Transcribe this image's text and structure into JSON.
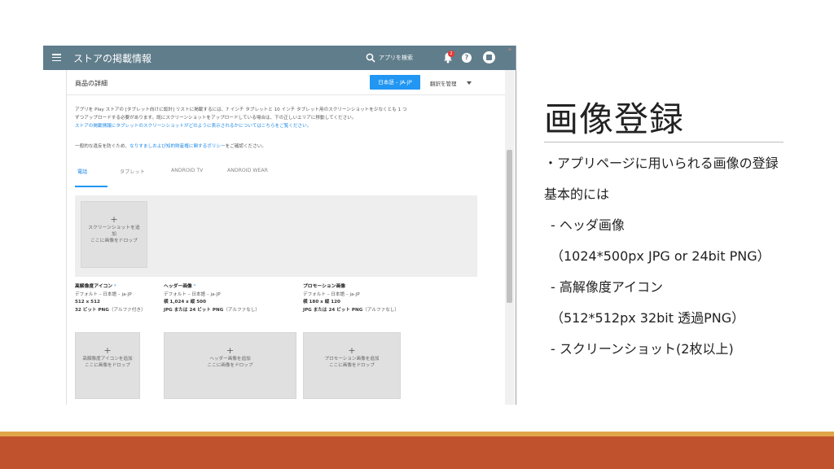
{
  "slide": {
    "title": "画像登録",
    "bullets": [
      "・アプリページに用いられる画像の登録",
      "基本的には",
      "- ヘッダ画像",
      "（1024*500px JPG or 24bit PNG）",
      "- 高解像度アイコン",
      "（512*512px 32bit 透過PNG）",
      "- スクリーンショット(2枚以上)"
    ],
    "colors": {
      "footer_thin": "#e0a54a",
      "footer_bar": "#c0522d"
    }
  },
  "app": {
    "title": "ストアの掲載情報",
    "search_placeholder": "アプリを検索",
    "notification_count": "2",
    "help_label": "?",
    "colors": {
      "topbar": "#607d8b",
      "accent": "#2196f3"
    }
  },
  "content": {
    "heading": "商品の詳細",
    "language_button": "日本語 – JA-JP",
    "translate_button": "翻訳を管理",
    "desc_line1": "アプリを Play ストアの [タブレット向けに設計] リストに掲載するには、7 インチ タブレットと 10 インチ タブレット用のスクリーンショットを少なくとも 1 つ",
    "desc_line2": "ずつアップロードする必要があります。既にスクリーンショットをアップロードしている場合は、下の正しいエリアに移動してください。",
    "desc_link": "ストアの掲載情報にタブレットのスクリーンショットがどのように表示されるかについてはこちらをご覧ください。",
    "policy_prefix": "一般的な違反を防ぐため、",
    "policy_link": "なりすましおよび知的財産権に関するポリシー",
    "policy_suffix": "をご確認ください。",
    "tabs": [
      "電話",
      "タブレット",
      "ANDROID TV",
      "ANDROID WEAR"
    ],
    "screenshot_drop_line1": "スクリーンショットを追",
    "screenshot_drop_line2": "加",
    "screenshot_drop_line3": "ここに画像をドロップ",
    "plus": "+",
    "assets": [
      {
        "title": "高解像度アイコン",
        "required": "*",
        "lang": "デフォルト – 日本語 – ja-JP",
        "size": "512 x 512",
        "format_bold": "32 ビット PNG",
        "format_rest": "（アルファ付き）",
        "drop_line1": "高解像度アイコンを追加",
        "drop_line2": "ここに画像をドロップ"
      },
      {
        "title": "ヘッダー画像",
        "required": "*",
        "lang": "デフォルト – 日本語 – ja-JP",
        "size": "横 1,024 x 縦 500",
        "format_bold": "JPG または 24 ビット PNG",
        "format_rest": "（アルファなし）",
        "drop_line1": "ヘッダー画像を追加",
        "drop_line2": "ここに画像をドロップ"
      },
      {
        "title": "プロモーション画像",
        "required": "",
        "lang": "デフォルト – 日本語 – ja-JP",
        "size": "横 180 x 縦 120",
        "format_bold": "JPG または 24 ビット PNG",
        "format_rest": "（アルファなし）",
        "drop_line1": "プロモーション画像を追加",
        "drop_line2": "ここに画像をドロップ"
      }
    ]
  }
}
